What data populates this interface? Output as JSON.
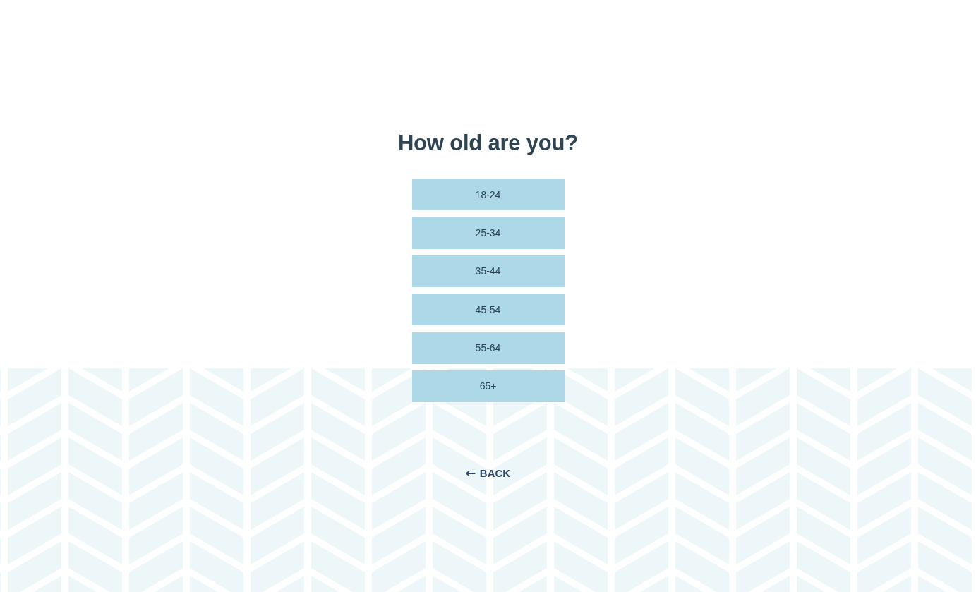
{
  "title": "How old are you?",
  "options": [
    {
      "label": "18-24"
    },
    {
      "label": "25-34"
    },
    {
      "label": "35-44"
    },
    {
      "label": "45-54"
    },
    {
      "label": "55-64"
    },
    {
      "label": "65+"
    }
  ],
  "back": {
    "label": "BACK"
  }
}
